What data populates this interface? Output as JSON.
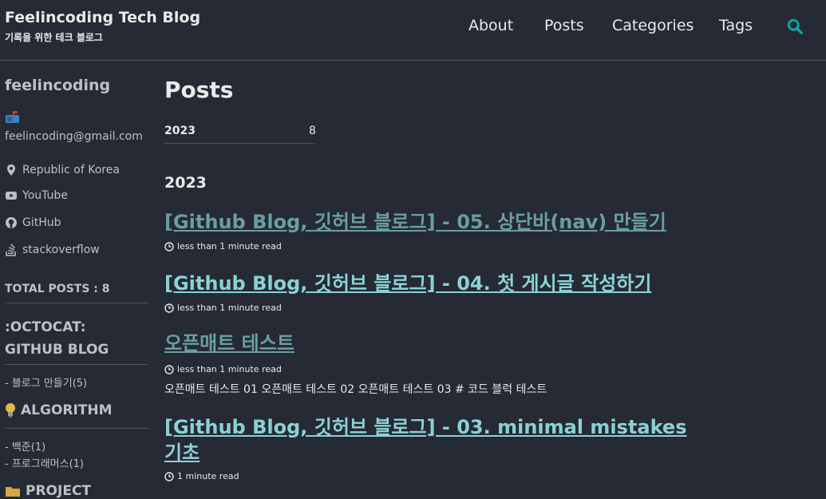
{
  "header": {
    "site_title": "Feelincoding Tech Blog",
    "site_subtitle": "기록을 위한 테크 블로그",
    "nav": [
      "About",
      "Posts",
      "Categories",
      "Tags"
    ],
    "accent": "#00adb5"
  },
  "sidebar": {
    "author_name": "feelincoding",
    "email": "feelincoding@gmail.com",
    "location": "Republic of Korea",
    "links": [
      "YouTube",
      "GitHub",
      "stackoverflow"
    ],
    "total_posts": "TOTAL POSTS : 8",
    "categories": [
      {
        "heading": ":OCTOCAT: GITHUB BLOG",
        "items": [
          "- 블로그 만들기(5)"
        ]
      },
      {
        "heading": "ALGORITHM",
        "items": [
          "- 백준(1)",
          "- 프로그래머스(1)"
        ]
      },
      {
        "heading": "PROJECT",
        "items": []
      }
    ]
  },
  "main": {
    "page_title": "Posts",
    "year_nav": {
      "year": "2023",
      "count": "8"
    },
    "year_heading": "2023",
    "posts": [
      {
        "title": "[Github Blog, 깃허브 블로그] - 05. 상단바(nav) 만들기",
        "read_time": "less than 1 minute read",
        "color": "#6a9ea2"
      },
      {
        "title": "[Github Blog, 깃허브 블로그] - 04. 첫 게시글 작성하기",
        "read_time": "less than 1 minute read",
        "color": "#8ad2d6"
      },
      {
        "title": "오픈매트 테스트",
        "read_time": "less than 1 minute read",
        "excerpt": "오픈매트 테스트 01 오픈매트 테스트 02 오픈매트 테스트 03 # 코드 블럭 테스트",
        "color": "#6a9ea2"
      },
      {
        "title_line1": "[Github Blog, 깃허브 블로그] - 03. minimal mistakes",
        "title_line2": "기초",
        "read_time": "1 minute read",
        "color": "#8ad2d6"
      }
    ]
  }
}
